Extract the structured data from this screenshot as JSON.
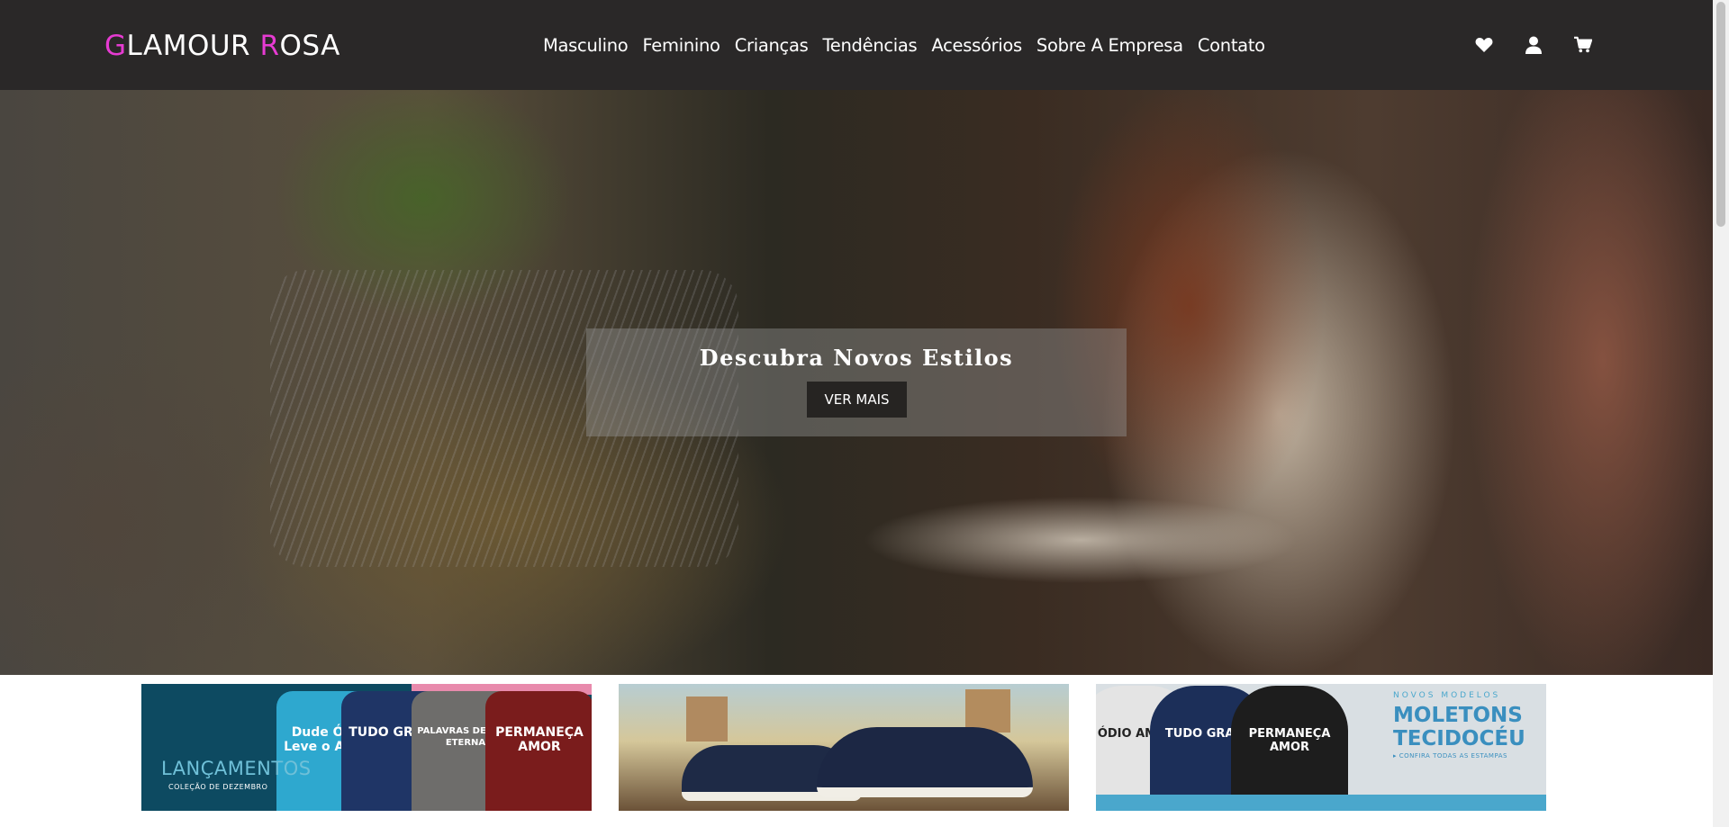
{
  "brand": {
    "first_letter": "G",
    "first_rest": "LAMOUR ",
    "second_letter": "R",
    "second_rest": "OSA",
    "accent_color": "#e63bd2"
  },
  "nav": {
    "items": [
      {
        "label": "Masculino"
      },
      {
        "label": "Feminino"
      },
      {
        "label": "Crianças"
      },
      {
        "label": "Tendências"
      },
      {
        "label": "Acessórios"
      },
      {
        "label": "Sobre A Empresa"
      },
      {
        "label": "Contato"
      }
    ]
  },
  "header_icons": [
    "heart-icon",
    "user-icon",
    "cart-icon"
  ],
  "hero": {
    "title": "Descubra Novos Estilos",
    "button_label": "VER MAIS"
  },
  "banners": {
    "launches": {
      "title": "LANÇAMENTOS",
      "subtitle": "COLEÇÃO DE DEZEMBRO",
      "shirts": [
        "Dude ÓDIO Leve o AMOR",
        "TUDO GRAÇA",
        "PALAVRAS DE VIDA ETERNA",
        "PERMANEÇA AMOR"
      ]
    },
    "hoodies": {
      "kicker": "NOVOS MODELOS",
      "title_line1": "MOLETONS",
      "title_line2": "TECIDOCÉU",
      "cta": "CONFIRA TODAS AS ESTAMPAS",
      "hoodie_texts": [
        "ÓDIO AMOR",
        "TUDO GRAÇA",
        "PERMANEÇA AMOR"
      ]
    }
  },
  "colors": {
    "header_bg": "#2a2828",
    "button_bg": "#262422"
  }
}
